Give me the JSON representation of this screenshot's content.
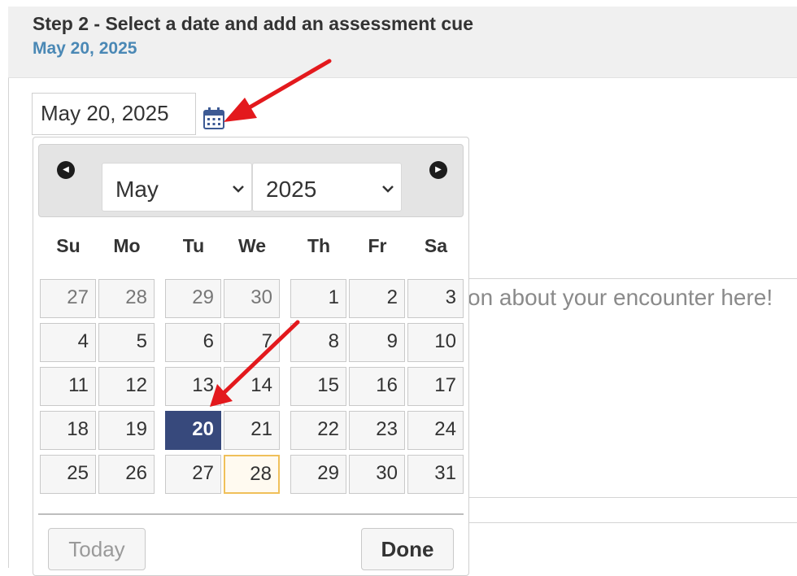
{
  "header": {
    "title": "Step 2 - Select a date and add an assessment cue",
    "selected_date": "May 20, 2025"
  },
  "date_input": {
    "value": "May 20, 2025"
  },
  "icons": {
    "calendar": "calendar-icon",
    "prev": "circle-left-icon",
    "next": "circle-right-icon"
  },
  "datepicker": {
    "month": "May",
    "year": "2025",
    "weekdays": [
      "Su",
      "Mo",
      "Tu",
      "We",
      "Th",
      "Fr",
      "Sa"
    ],
    "weeks": [
      [
        "27",
        "28",
        "29",
        "30",
        "1",
        "2",
        "3"
      ],
      [
        "4",
        "5",
        "6",
        "7",
        "8",
        "9",
        "10"
      ],
      [
        "11",
        "12",
        "13",
        "14",
        "15",
        "16",
        "17"
      ],
      [
        "18",
        "19",
        "20",
        "21",
        "22",
        "23",
        "24"
      ],
      [
        "25",
        "26",
        "27",
        "28",
        "29",
        "30",
        "31"
      ]
    ],
    "selected_day": "20",
    "today_day": "28",
    "today_label": "Today",
    "done_label": "Done"
  },
  "textarea": {
    "placeholder_visible": "on about your encounter here!"
  },
  "colors": {
    "annotation_arrow": "#e3191d",
    "selected": "#37497c",
    "accent": "#4a88b5",
    "today_border": "#f0c05a"
  }
}
